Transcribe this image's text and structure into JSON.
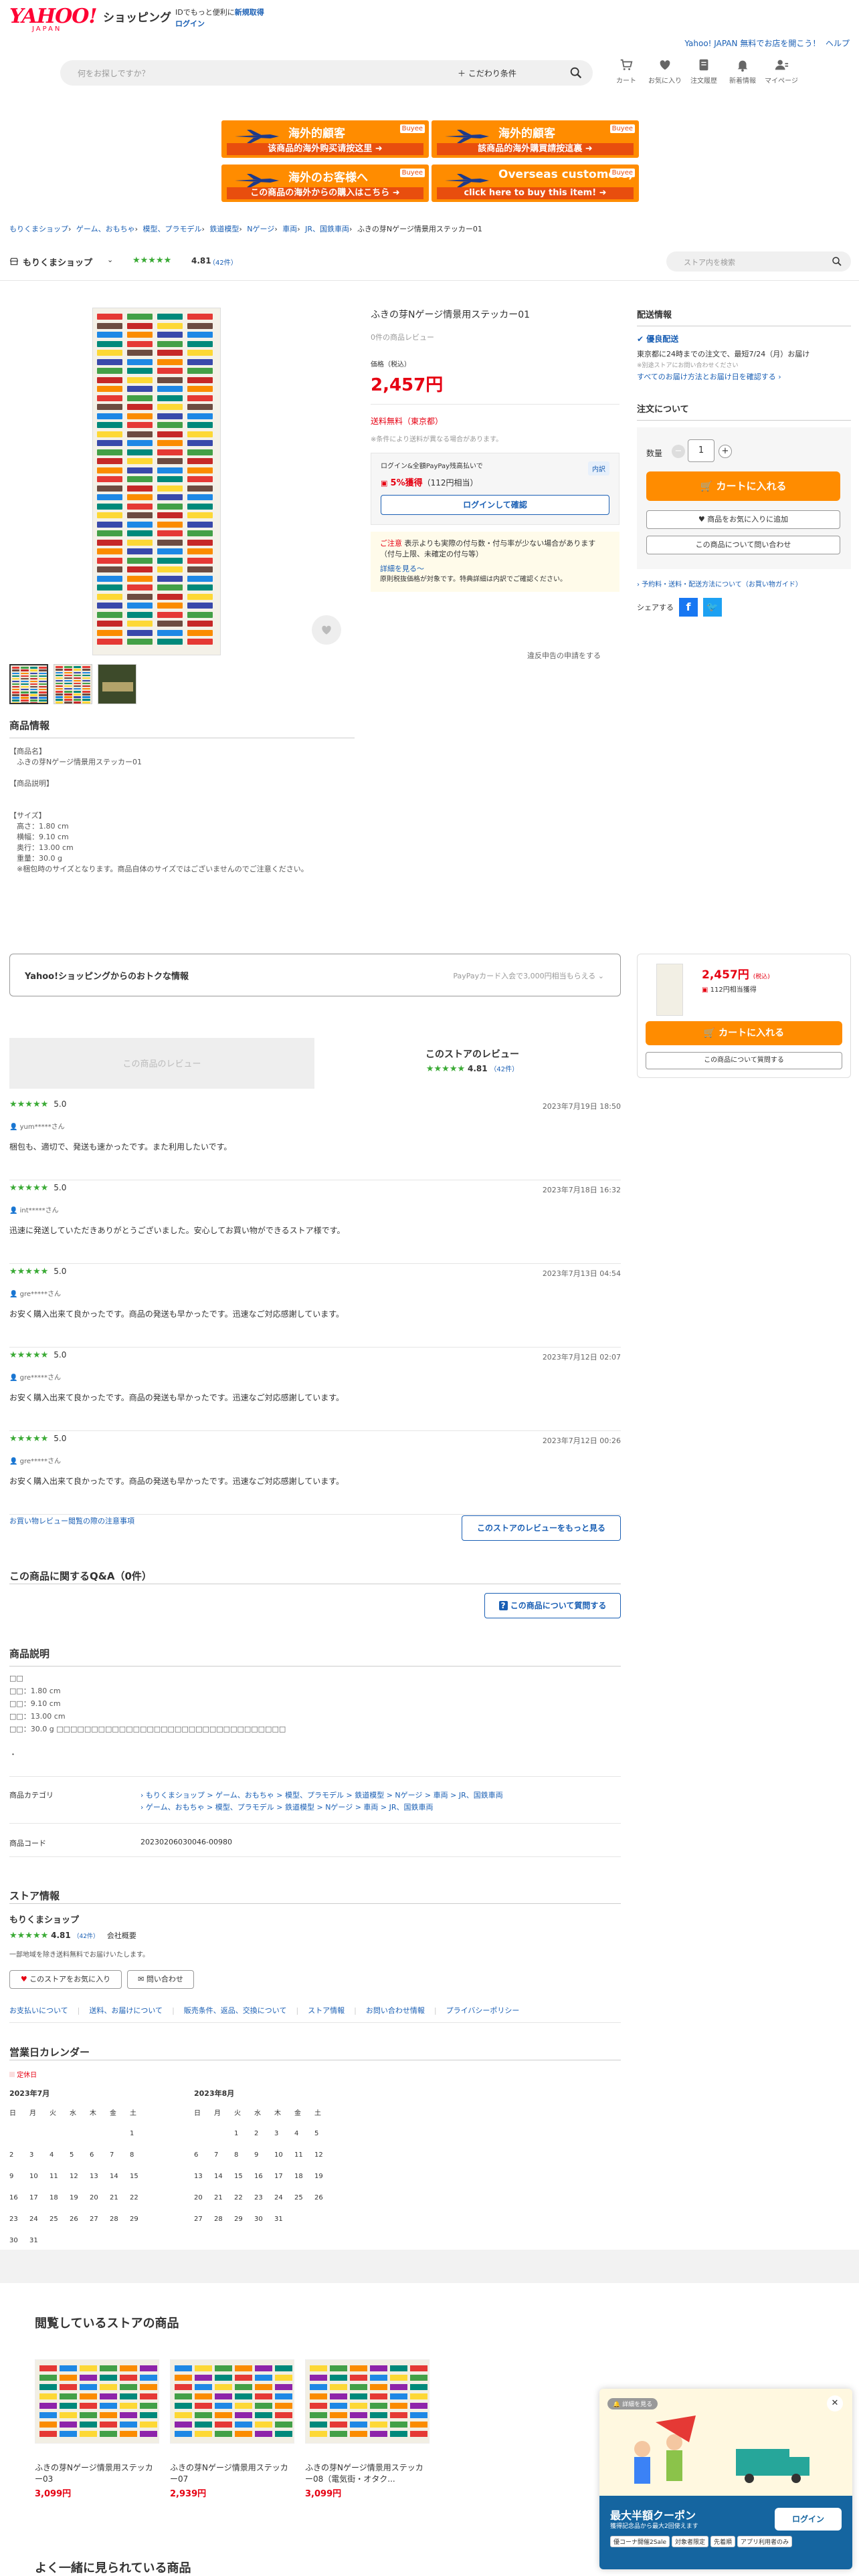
{
  "header": {
    "logo_main": "YAHOO!",
    "logo_sub": "JAPAN",
    "shopping": "ショッピング",
    "promo_text": "IDでもっと便利に",
    "register": "新規取得",
    "login": "ログイン",
    "top_right_link": "Yahoo! JAPAN",
    "top_right_link2": "無料でお店を開こう！",
    "help": "ヘルプ"
  },
  "search": {
    "placeholder": "何をお探しですか？",
    "keyword_plus": "＋ こだわり条件"
  },
  "icons": [
    {
      "label": "カート"
    },
    {
      "label": "お気に入り"
    },
    {
      "label": "注文履歴"
    },
    {
      "label": "新着情報"
    },
    {
      "label": "マイページ"
    }
  ],
  "banners": [
    {
      "title": "海外的顧客",
      "sub": "该商品的海外购买请按这里 ➜",
      "brand": "Buyee"
    },
    {
      "title": "海外的顧客",
      "sub": "該商品的海外購買請按這裏 ➜",
      "brand": "Buyee"
    },
    {
      "title": "海外のお客様へ",
      "sub": "この商品の海外からの購入はこちら ➜",
      "brand": "Buyee"
    },
    {
      "title": "Overseas customers,",
      "sub": "click here to buy this item! ➜",
      "brand": "Buyee"
    }
  ],
  "breadcrumb": [
    "もりくまショップ",
    "ゲーム、おもちゃ",
    "模型、プラモデル",
    "鉄道模型",
    "Nゲージ",
    "車両",
    "JR、国鉄車両",
    "ふきの芽Nゲージ情景用ステッカー01"
  ],
  "store": {
    "name": "もりくまショップ",
    "rating": "4.81",
    "reviews": "（42件）",
    "search_placeholder": "ストア内を検索"
  },
  "product": {
    "title": "ふきの芽Nゲージ情景用ステッカー01",
    "review_none": "0件の商品レビュー",
    "price_label": "価格（税込）",
    "price": "2,457円",
    "shipping": "送料無料（東京都）",
    "shipping_note": "※条件により送料が異なる場合があります。",
    "paypay_note": "ログイン&全額PayPay残高払いで",
    "breakdown": "内訳",
    "points": "5%獲得",
    "points_sub": "（112円相当）",
    "login_confirm": "ログインして確認",
    "caution_label": "ご注意",
    "caution_text": "表示よりも実際の付与数・付与率が少ない場合があります（付与上限、未確定の付与等）",
    "detail_link": "詳細を見る～",
    "caution_sub": "原則税抜価格が対象です。特典詳細は内訳でご確認ください。",
    "report": "違反申告の申請をする"
  },
  "delivery": {
    "heading": "配送情報",
    "badge": "優良配送",
    "text": "東京都に24時までの注文で、最短7/24（月）お届け",
    "note1": "※別途ストアにお問い合わせください",
    "note2": "すべてのお届け方法とお届け日を確認する ›"
  },
  "order": {
    "heading": "注文について",
    "qty_label": "数量",
    "qty_value": "1",
    "minus": "−",
    "plus": "+",
    "cart_btn": "カートに入れる",
    "fav_btn": "商品をお気に入りに追加",
    "inquiry_btn": "この商品について問い合わせ",
    "guide": "› 予約料・送料・配送方法について（お買い物ガイド）",
    "share": "シェアする"
  },
  "info": {
    "heading": "商品情報",
    "lines": [
      "【商品名】",
      "　ふきの芽Nゲージ情景用ステッカー01",
      "",
      "【商品説明】",
      "",
      "",
      "【サイズ】",
      "　高さ：1.80 cm",
      "　横幅：9.10 cm",
      "　奥行：13.00 cm",
      "　重量：30.0 g",
      "　※梱包時のサイズとなります。商品自体のサイズではございませんのでご注意ください。"
    ]
  },
  "deals": {
    "title": "Yahoo!ショッピングからのおトクな情報",
    "right": "PayPayカード入会で3,000円相当もらえる ⌄"
  },
  "side2": {
    "price": "2,457円",
    "tax": "(税込)",
    "points": "112円相当獲得",
    "cart": "カートに入れる",
    "inquiry": "この商品について質問する"
  },
  "reviews": {
    "product_tab": "この商品のレビュー",
    "store_tab": "このストアのレビュー",
    "store_rating": "4.81",
    "store_count": "（42件）",
    "items": [
      {
        "score": "5.0",
        "date": "2023年7月19日 18:50",
        "user": "yum*****さん",
        "text": "梱包も、適切で、発送も速かったです。また利用したいです。"
      },
      {
        "score": "5.0",
        "date": "2023年7月18日 16:32",
        "user": "int*****さん",
        "text": "迅速に発送していただきありがとうございました。安心してお買い物ができるストア様です。"
      },
      {
        "score": "5.0",
        "date": "2023年7月13日 04:54",
        "user": "gre*****さん",
        "text": "お安く購入出来て良かったです。商品の発送も早かったです。迅速なご対応感謝しています。"
      },
      {
        "score": "5.0",
        "date": "2023年7月12日 02:07",
        "user": "gre*****さん",
        "text": "お安く購入出来て良かったです。商品の発送も早かったです。迅速なご対応感謝しています。"
      },
      {
        "score": "5.0",
        "date": "2023年7月12日 00:26",
        "user": "gre*****さん",
        "text": "お安く購入出来て良かったです。商品の発送も早かったです。迅速なご対応感謝しています。"
      }
    ],
    "caution_link": "お買い物レビュー閲覧の際の注意事項",
    "more_btn": "このストアのレビューをもっと見る"
  },
  "qa": {
    "heading": "この商品に関するQ&A（0件）",
    "ask_btn": "この商品について質問する"
  },
  "desc": {
    "heading": "商品説明",
    "lines": [
      "□□",
      "□□：1.80 cm",
      "□□：9.10 cm",
      "□□：13.00 cm",
      "□□：30.0 g □□□□□□□□□□□□□□□□□□□□□□□□□□□□□□□□□",
      "",
      "・"
    ]
  },
  "category": {
    "label": "商品カテゴリ",
    "line1": "› もりくまショップ > ゲーム、おもちゃ > 模型、プラモデル > 鉄道模型 > Nゲージ > 車両 > JR、国鉄車両",
    "line2": "› ゲーム、おもちゃ > 模型、プラモデル > 鉄道模型 > Nゲージ > 車両 > JR、国鉄車両",
    "code_label": "商品コード",
    "code": "20230206030046-00980"
  },
  "storeinfo": {
    "heading": "ストア情報",
    "name": "もりくまショップ",
    "rating": "4.81",
    "count": "（42件）",
    "company": "会社概要",
    "note": "一部地域を除き送料無料でお届けいたします。",
    "fav_btn": "このストアをお気に入り",
    "contact_btn": "問い合わせ",
    "links": [
      "お支払いについて",
      "送料、お届けについて",
      "販売条件、返品、交換について",
      "ストア情報",
      "お問い合わせ情報",
      "プライバシーポリシー"
    ]
  },
  "calendar": {
    "heading": "営業日カレンダー",
    "legend": "定休日",
    "months": [
      {
        "title": "2023年7月",
        "days": [
          "日",
          "月",
          "火",
          "水",
          "木",
          "金",
          "土"
        ],
        "rows": [
          [
            "",
            "",
            "",
            "",
            "",
            "",
            "1"
          ],
          [
            "2",
            "3",
            "4",
            "5",
            "6",
            "7",
            "8"
          ],
          [
            "9",
            "10",
            "11",
            "12",
            "13",
            "14",
            "15"
          ],
          [
            "16",
            "17",
            "18",
            "19",
            "20",
            "21",
            "22"
          ],
          [
            "23",
            "24",
            "25",
            "26",
            "27",
            "28",
            "29"
          ],
          [
            "30",
            "31",
            "",
            "",
            "",
            "",
            ""
          ]
        ]
      },
      {
        "title": "2023年8月",
        "days": [
          "日",
          "月",
          "火",
          "水",
          "木",
          "金",
          "土"
        ],
        "rows": [
          [
            "",
            "",
            "1",
            "2",
            "3",
            "4",
            "5"
          ],
          [
            "6",
            "7",
            "8",
            "9",
            "10",
            "11",
            "12"
          ],
          [
            "13",
            "14",
            "15",
            "16",
            "17",
            "18",
            "19"
          ],
          [
            "20",
            "21",
            "22",
            "23",
            "24",
            "25",
            "26"
          ],
          [
            "27",
            "28",
            "29",
            "30",
            "31",
            "",
            ""
          ]
        ]
      }
    ]
  },
  "viewed": {
    "heading": "閲覧しているストアの商品",
    "items": [
      {
        "name": "ふきの芽Nゲージ情景用ステッカー03",
        "price": "3,099円"
      },
      {
        "name": "ふきの芽Nゲージ情景用ステッカー07",
        "price": "2,939円"
      },
      {
        "name": "ふきの芽Nゲージ情景用ステッカー08（電気街・オタク...",
        "price": "3,099円"
      }
    ]
  },
  "also": {
    "heading": "よく一緒に見られている商品"
  },
  "popup": {
    "badge": "詳細を見る",
    "title": "最大半額クーポン",
    "sub": "獲得記念品から最大2回使えます",
    "tags": [
      "優コーナ開催2Sale",
      "対象者限定",
      "先着順",
      "アプリ利用者のみ"
    ],
    "login": "ログイン",
    "close": "✕"
  },
  "colors": {
    "accent": "#ff8c00",
    "price": "#e60012",
    "star": "#3aaa35",
    "link": "#1a5fb4"
  }
}
